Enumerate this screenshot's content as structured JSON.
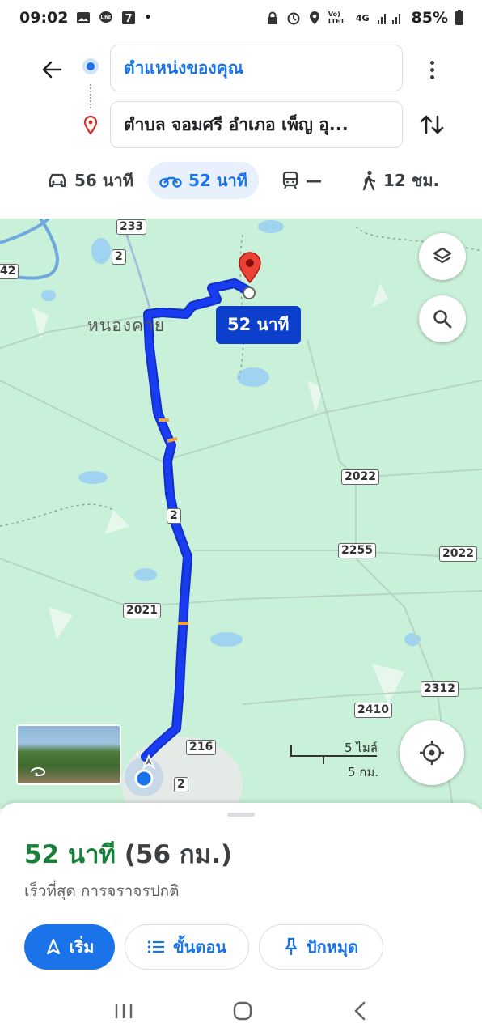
{
  "status_bar": {
    "time": "09:02",
    "battery": "85%",
    "network": "4G",
    "volte": "Vo) LTE1"
  },
  "search": {
    "origin": "ตำแหน่งของคุณ",
    "destination": "ตำบล จอมศรี อำเภอ เพ็ญ อุ..."
  },
  "modes": [
    {
      "icon": "car-icon",
      "label": "56 นาที"
    },
    {
      "icon": "motorcycle-icon",
      "label": "52 นาที"
    },
    {
      "icon": "transit-icon",
      "label": "—"
    },
    {
      "icon": "walk-icon",
      "label": "12 ชม."
    }
  ],
  "map": {
    "route_time": "52 นาที",
    "town": "หนองคาย",
    "roads": [
      "233",
      "2",
      "42",
      "2",
      "2022",
      "2255",
      "2022",
      "2021",
      "2312",
      "2410",
      "216",
      "2"
    ],
    "scale": {
      "miles": "5 ไมล์",
      "km": "5 กม."
    }
  },
  "colors": {
    "route": "#1a3cf0",
    "accent": "#1a73e8",
    "duration": "#188038",
    "map_bg": "#c9f0d8"
  },
  "sheet": {
    "duration": "52 นาที",
    "distance": "(56 กม.)",
    "note": "เร็วที่สุด การจราจรปกติ",
    "start_label": "เริ่ม",
    "steps_label": "ขั้นตอน",
    "pin_label": "ปักหมุด"
  }
}
